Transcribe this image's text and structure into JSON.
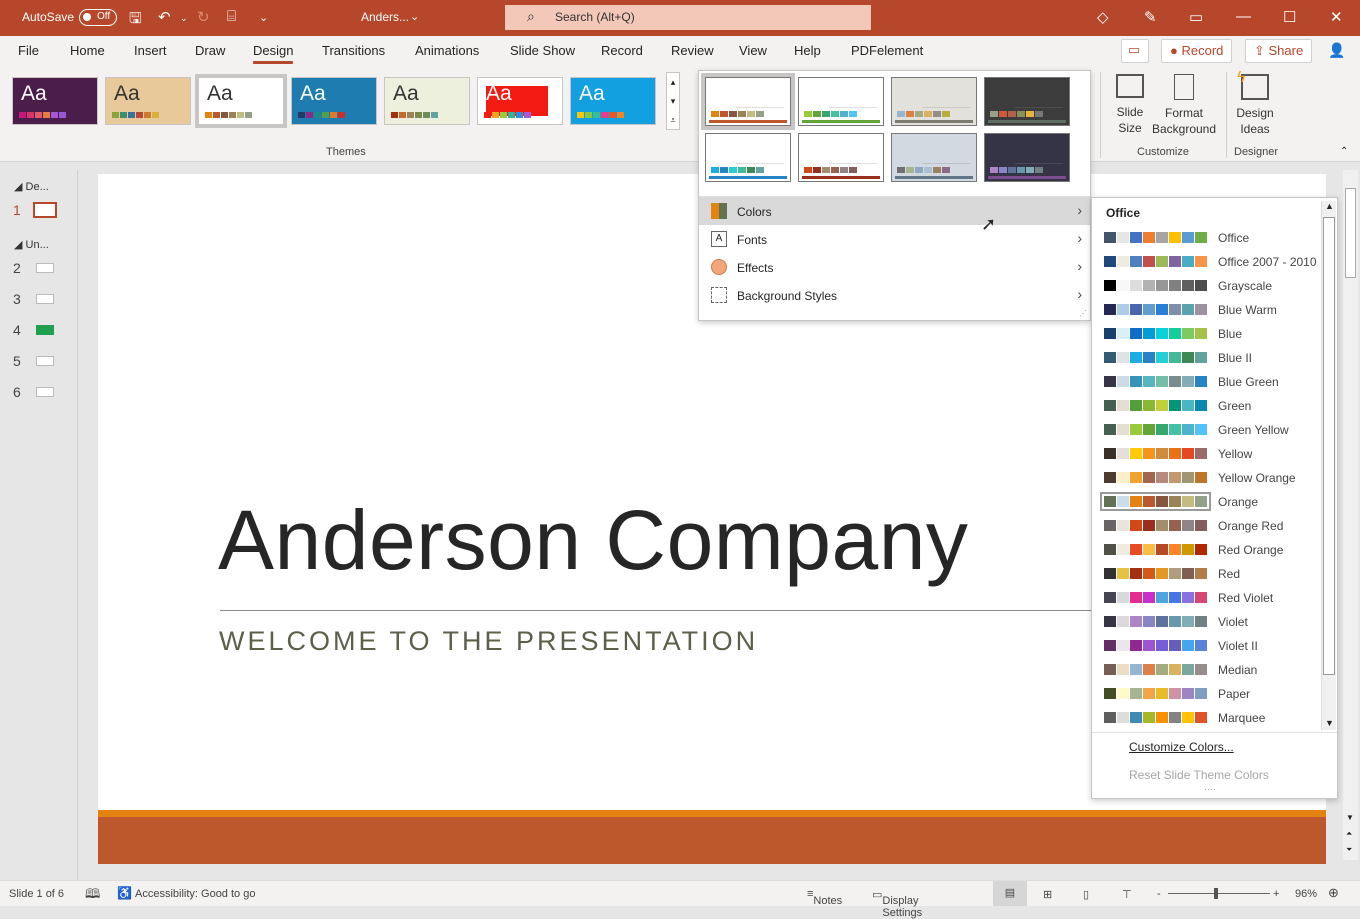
{
  "titlebar": {
    "autosave_label": "AutoSave",
    "autosave_state": "Off",
    "doc_title": "Anders...",
    "search_placeholder": "Search (Alt+Q)"
  },
  "tabs": [
    "File",
    "Home",
    "Insert",
    "Draw",
    "Design",
    "Transitions",
    "Animations",
    "Slide Show",
    "Record",
    "Review",
    "View",
    "Help",
    "PDFelement"
  ],
  "active_tab": "Design",
  "tab_buttons": {
    "record": "Record",
    "share": "Share"
  },
  "ribbon": {
    "themes_group": "Themes",
    "themes": [
      {
        "bg": "#4b1d4a",
        "fg": "#ffffff",
        "swatches": [
          "#c4187b",
          "#d9356b",
          "#e5586b",
          "#e77e3e",
          "#a259d3",
          "#9b56d6"
        ]
      },
      {
        "bg": "#e8c99a",
        "fg": "#333333",
        "swatches": [
          "#8aa33c",
          "#3f8d6e",
          "#3f6e9b",
          "#b24a35",
          "#d07a2f",
          "#d7b13a"
        ]
      },
      {
        "bg": "#ffffff",
        "fg": "#333333",
        "swatches": [
          "#e48312",
          "#bd582c",
          "#865640",
          "#9b8357",
          "#c2bc80",
          "#94a088"
        ]
      },
      {
        "bg": "#1f7cb0",
        "fg": "#ffffff",
        "swatches": [
          "#1f3c68",
          "#8e2a82",
          "#1e8b8a",
          "#4ca04f",
          "#e07a2a",
          "#c7312d"
        ]
      },
      {
        "bg": "#eef0de",
        "fg": "#333333",
        "swatches": [
          "#a5300f",
          "#c66b2a",
          "#9b8357",
          "#7b8a4a",
          "#6b8e58",
          "#62a39f"
        ]
      },
      {
        "bg": "#ffffff",
        "fg": "#ffffff",
        "swatches": [
          "#f41b12",
          "#f7a21b",
          "#9acb3c",
          "#37b29a",
          "#3b8ad6",
          "#a55bd6"
        ]
      },
      {
        "bg": "#12a0e0",
        "fg": "#ffffff",
        "swatches": [
          "#f5c60b",
          "#8cc63f",
          "#2ec295",
          "#e83d8c",
          "#e8562a",
          "#f58322"
        ]
      }
    ],
    "customize_group": "Customize",
    "slide_size": "Slide Size",
    "format_background": "Format Background",
    "designer_group": "Designer",
    "design_ideas": "Design Ideas"
  },
  "variants": [
    {
      "bg": "#ffffff",
      "bar": "#bd582c",
      "swatches": [
        "#e48312",
        "#bd582c",
        "#865640",
        "#9b8357",
        "#c2bc80",
        "#94a088"
      ],
      "selected": true
    },
    {
      "bg": "#ffffff",
      "bar": "#63a537",
      "swatches": [
        "#99cb38",
        "#63a537",
        "#37a76f",
        "#44c1a3",
        "#4eb3cf",
        "#51c3f9"
      ]
    },
    {
      "bg": "#e2e1dc",
      "bar": "#7b7b73",
      "swatches": [
        "#94b6d2",
        "#dd8047",
        "#a5ab81",
        "#d8b25c",
        "#968c8c",
        "#b5b03d"
      ]
    },
    {
      "bg": "#3c3c3c",
      "bar": "#5e6e62",
      "swatches": [
        "#94a088",
        "#d5573b",
        "#b0614a",
        "#8e8d5c",
        "#e6b43f",
        "#777777"
      ]
    },
    {
      "bg": "#ffffff",
      "bar": "#2683c6",
      "swatches": [
        "#1cade4",
        "#2683c6",
        "#27ced7",
        "#42ba97",
        "#3e8853",
        "#62a39f"
      ]
    },
    {
      "bg": "#ffffff",
      "bar": "#9b2d1f",
      "swatches": [
        "#d34817",
        "#9b2d1f",
        "#a28e6a",
        "#956251",
        "#918485",
        "#855d5d"
      ]
    },
    {
      "bg": "#d2d9e0",
      "bar": "#627689",
      "swatches": [
        "#6f6f74",
        "#a4b592",
        "#90a9c0",
        "#a9c1d1",
        "#9b8160",
        "#8b6a8a"
      ]
    },
    {
      "bg": "#353447",
      "bar": "#7b4c92",
      "swatches": [
        "#ad84c6",
        "#8784c7",
        "#5d739a",
        "#6997af",
        "#84acb6",
        "#6f8183"
      ]
    }
  ],
  "menu": [
    {
      "label": "Colors",
      "icon": "colors-icon"
    },
    {
      "label": "Fonts",
      "icon": "fonts-icon"
    },
    {
      "label": "Effects",
      "icon": "effects-icon"
    },
    {
      "label": "Background Styles",
      "icon": "background-styles-icon"
    }
  ],
  "colors_menu": {
    "header": "Office",
    "selected": "Orange",
    "palettes": [
      {
        "name": "Office",
        "colors": [
          "#44546a",
          "#e7e6e6",
          "#4472c4",
          "#ed7d31",
          "#a5a5a5",
          "#ffc000",
          "#5b9bd5",
          "#70ad47"
        ]
      },
      {
        "name": "Office 2007 - 2010",
        "colors": [
          "#1f497d",
          "#eeece1",
          "#4f81bd",
          "#c0504d",
          "#9bbb59",
          "#8064a2",
          "#4bacc6",
          "#f79646"
        ]
      },
      {
        "name": "Grayscale",
        "colors": [
          "#000000",
          "#f8f8f8",
          "#dddddd",
          "#b2b2b2",
          "#969696",
          "#808080",
          "#5f5f5f",
          "#4d4d4d"
        ]
      },
      {
        "name": "Blue Warm",
        "colors": [
          "#242852",
          "#acccea",
          "#4a66ac",
          "#629dd1",
          "#297fd5",
          "#7f8fa9",
          "#5aa2ae",
          "#9d90a0"
        ]
      },
      {
        "name": "Blue",
        "colors": [
          "#17406d",
          "#dbeff9",
          "#0f6fc6",
          "#009dd9",
          "#0bd0d9",
          "#10cf9b",
          "#7cca62",
          "#a5c249"
        ]
      },
      {
        "name": "Blue II",
        "colors": [
          "#335b74",
          "#dfe3e5",
          "#1cade4",
          "#2683c6",
          "#27ced7",
          "#42ba97",
          "#3e8853",
          "#62a39f"
        ]
      },
      {
        "name": "Blue Green",
        "colors": [
          "#373545",
          "#cedbe6",
          "#3494ba",
          "#58b6c0",
          "#75bda7",
          "#7a8c8e",
          "#84acb6",
          "#2683c6"
        ]
      },
      {
        "name": "Green",
        "colors": [
          "#455f51",
          "#e3ded1",
          "#549e39",
          "#8ab833",
          "#c0cf3a",
          "#029676",
          "#4ab5c4",
          "#0989b1"
        ]
      },
      {
        "name": "Green Yellow",
        "colors": [
          "#455f51",
          "#e3ded1",
          "#99cb38",
          "#63a537",
          "#37a76f",
          "#44c1a3",
          "#4eb3cf",
          "#51c3f9"
        ]
      },
      {
        "name": "Yellow",
        "colors": [
          "#39302a",
          "#e5dedb",
          "#ffca08",
          "#f8931d",
          "#ce8d3e",
          "#ec7016",
          "#e64823",
          "#9c6a6a"
        ]
      },
      {
        "name": "Yellow Orange",
        "colors": [
          "#4e3b30",
          "#fbeec9",
          "#f0a22e",
          "#a5644e",
          "#b58b80",
          "#c3986d",
          "#a19574",
          "#c17529"
        ]
      },
      {
        "name": "Orange",
        "colors": [
          "#637052",
          "#ccddea",
          "#e48312",
          "#bd582c",
          "#865640",
          "#9b8357",
          "#c2bc80",
          "#94a088"
        ]
      },
      {
        "name": "Orange Red",
        "colors": [
          "#696464",
          "#e9e5dc",
          "#d34817",
          "#9b2d1f",
          "#a28e6a",
          "#956251",
          "#918485",
          "#855d5d"
        ]
      },
      {
        "name": "Red Orange",
        "colors": [
          "#505046",
          "#eeece1",
          "#e84c22",
          "#ffbd47",
          "#b64926",
          "#ff8427",
          "#cc9900",
          "#b22600"
        ]
      },
      {
        "name": "Red",
        "colors": [
          "#323232",
          "#e5c243",
          "#a5300f",
          "#d55816",
          "#e19825",
          "#b19c7d",
          "#7f5f52",
          "#b27d49"
        ]
      },
      {
        "name": "Red Violet",
        "colors": [
          "#454551",
          "#d8d9dc",
          "#e32d91",
          "#c830cc",
          "#4ea6dc",
          "#4775e7",
          "#8971e1",
          "#d54773"
        ]
      },
      {
        "name": "Violet",
        "colors": [
          "#373545",
          "#dcd8dc",
          "#ad84c6",
          "#8784c7",
          "#5d739a",
          "#6997af",
          "#84acb6",
          "#6f8183"
        ]
      },
      {
        "name": "Violet II",
        "colors": [
          "#632e62",
          "#eae5eb",
          "#92278f",
          "#9b57d3",
          "#755dd9",
          "#665eb8",
          "#45a5ed",
          "#5982db"
        ]
      },
      {
        "name": "Median",
        "colors": [
          "#775f55",
          "#ebddc3",
          "#94b6d2",
          "#dd8047",
          "#a5ab81",
          "#d8b25c",
          "#7ba79d",
          "#968c8c"
        ]
      },
      {
        "name": "Paper",
        "colors": [
          "#444d26",
          "#fefac9",
          "#a5b592",
          "#f3a447",
          "#e7bc29",
          "#d092a7",
          "#9c85c0",
          "#809ec2"
        ]
      },
      {
        "name": "Marquee",
        "colors": [
          "#5e5e5e",
          "#dddddd",
          "#418ab3",
          "#a6b727",
          "#f69200",
          "#838383",
          "#fec306",
          "#df5327"
        ]
      }
    ],
    "customize": "Customize Colors...",
    "reset": "Reset Slide Theme Colors"
  },
  "thumbnails": {
    "sections": [
      "De...",
      "Un..."
    ],
    "slides": [
      "1",
      "2",
      "3",
      "4",
      "5",
      "6"
    ],
    "selected": "1"
  },
  "slide": {
    "title": "Anderson Company",
    "subtitle": "WELCOME TO THE PRESENTATION"
  },
  "status": {
    "slide": "Slide 1 of 6",
    "accessibility": "Accessibility: Good to go",
    "notes": "Notes",
    "display": "Display Settings",
    "zoom": "96%",
    "zoom_minus": "-",
    "zoom_plus": "+"
  },
  "accent": "#b7472a"
}
